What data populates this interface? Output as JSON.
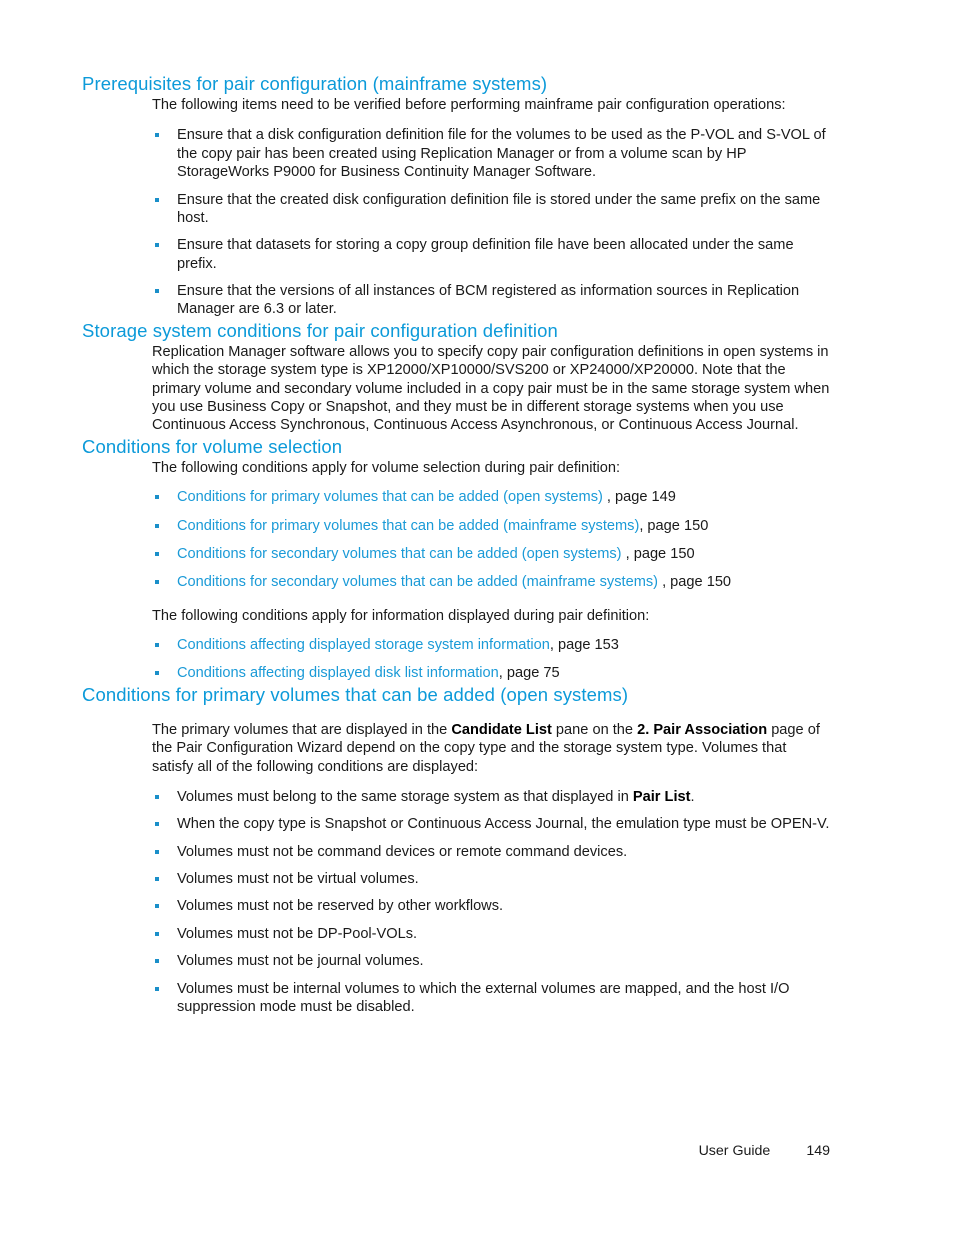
{
  "document": {
    "footer": {
      "label": "User Guide",
      "page_number": "149"
    },
    "colors": {
      "heading": "#0c9ad9",
      "link": "#1a9ad7",
      "bullet": "#1a8fc9",
      "body_text": "#1a1a1a",
      "background": "#ffffff"
    }
  },
  "sections": {
    "prerequisites": {
      "heading": "Prerequisites for pair configuration (mainframe systems)",
      "intro": "The following items need to be verified before performing mainframe pair configuration operations:",
      "bullets": [
        "Ensure that a disk configuration definition file for the volumes to be used as the P-VOL and S-VOL of the copy pair has been created using Replication Manager or from a volume scan by HP StorageWorks P9000 for Business Continuity Manager Software.",
        "Ensure that the created disk configuration definition file is stored under the same prefix on the same host.",
        "Ensure that datasets for storing a copy group definition file have been allocated under the same prefix.",
        "Ensure that the versions of all instances of BCM registered as information sources in Replication Manager are 6.3 or later."
      ]
    },
    "storage_system_conditions": {
      "heading": "Storage system conditions for pair configuration definition",
      "paragraph": "Replication Manager software allows you to specify copy pair configuration definitions in open systems in which the storage system type is XP12000/XP10000/SVS200 or XP24000/XP20000. Note that the primary volume and secondary volume included in a copy pair must be in the same storage system when you use Business Copy or Snapshot, and they must be in different storage systems when you use Continuous Access Synchronous, Continuous Access Asynchronous, or Continuous Access Journal."
    },
    "volume_selection": {
      "heading": "Conditions for volume selection",
      "intro_volume": "The following conditions apply for volume selection during pair definition:",
      "volume_links": [
        {
          "link": "Conditions for primary volumes that can be added (open systems)",
          "suffix": " , page 149"
        },
        {
          "link": "Conditions for primary volumes that can be added (mainframe systems)",
          "suffix": ", page 150"
        },
        {
          "link": "Conditions for secondary volumes that can be added (open systems)",
          "suffix": " , page 150"
        },
        {
          "link": "Conditions for secondary volumes that can be added (mainframe systems)",
          "suffix": "  , page 150"
        }
      ],
      "intro_information": "The following conditions apply for information displayed during pair definition:",
      "information_links": [
        {
          "link": "Conditions affecting displayed storage system information",
          "suffix": ", page 153"
        },
        {
          "link": "Conditions affecting displayed disk list information",
          "suffix": ", page 75"
        }
      ]
    },
    "primary_volumes_open": {
      "heading": "Conditions for primary volumes that can be added (open systems)",
      "paragraph_parts": {
        "p1": "The primary volumes that are displayed in the ",
        "bold1": "Candidate List",
        "p2": " pane on the ",
        "bold2": "2. Pair Association",
        "p3": " page of the Pair Configuration Wizard depend on the copy type and the storage system type. Volumes that satisfy all of the following conditions are displayed:"
      },
      "bullets": [
        {
          "prefix": "Volumes must belong to the same storage system as that displayed in ",
          "bold": "Pair List",
          "suffix": "."
        },
        {
          "prefix": "When the copy type is Snapshot or Continuous Access Journal, the emulation type must be OPEN-V.",
          "bold": "",
          "suffix": ""
        },
        {
          "prefix": "Volumes must not be command devices or remote command devices.",
          "bold": "",
          "suffix": ""
        },
        {
          "prefix": "Volumes must not be virtual volumes.",
          "bold": "",
          "suffix": ""
        },
        {
          "prefix": "Volumes must not be reserved by other workflows.",
          "bold": "",
          "suffix": ""
        },
        {
          "prefix": "Volumes must not be DP-Pool-VOLs.",
          "bold": "",
          "suffix": ""
        },
        {
          "prefix": "Volumes must not be journal volumes.",
          "bold": "",
          "suffix": ""
        },
        {
          "prefix": "Volumes must be internal volumes to which the external volumes are mapped, and the host I/O suppression mode must be disabled.",
          "bold": "",
          "suffix": ""
        }
      ]
    }
  }
}
